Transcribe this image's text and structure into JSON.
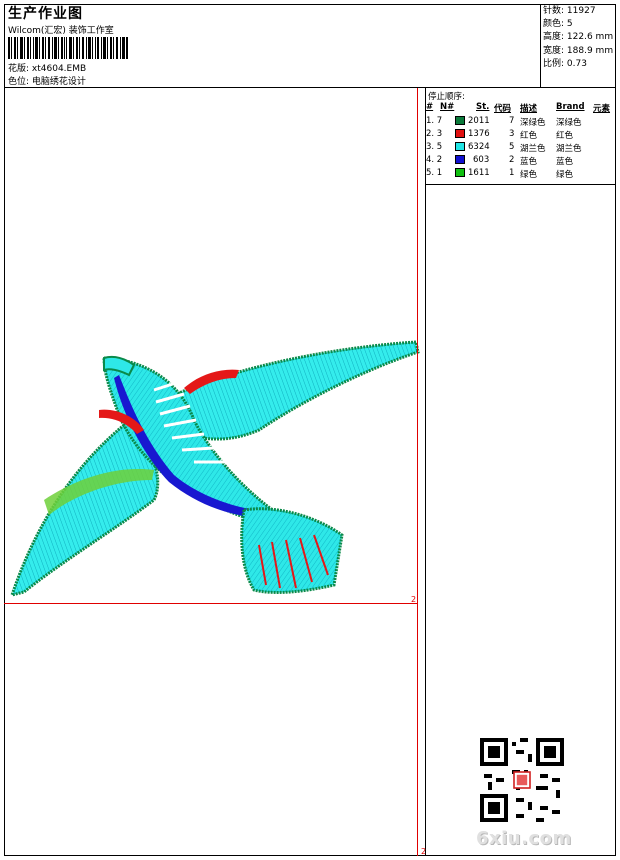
{
  "header": {
    "title": "生产作业图",
    "studio": "Wilcom(汇宏) 装饰工作室",
    "design_file_label": "花版:",
    "design_file": "xt4604.EMB",
    "color_position_label": "色位:",
    "color_position": "电脑绣花设计"
  },
  "stats": [
    {
      "label": "针数:",
      "value": "11927"
    },
    {
      "label": "颜色:",
      "value": "5"
    },
    {
      "label": "高度:",
      "value": "122.6 mm"
    },
    {
      "label": "宽度:",
      "value": "188.9 mm"
    },
    {
      "label": "比例:",
      "value": "0.73"
    }
  ],
  "sequence": {
    "title": "停止顺序:",
    "headers": {
      "hash": "#",
      "no": "N#",
      "st": "St.",
      "code": "代码",
      "desc": "描述",
      "brand": "Brand",
      "elem": "元素"
    },
    "rows": [
      {
        "hash": "1. 7",
        "color": "#0a7a3a",
        "st": "2011",
        "code": "7",
        "desc": "深绿色",
        "brand": "深绿色"
      },
      {
        "hash": "2. 3",
        "color": "#e01010",
        "st": "1376",
        "code": "3",
        "desc": "红色",
        "brand": "红色"
      },
      {
        "hash": "3. 5",
        "color": "#20e6e6",
        "st": "6324",
        "code": "5",
        "desc": "湖兰色",
        "brand": "湖兰色"
      },
      {
        "hash": "4. 2",
        "color": "#1010d0",
        "st": "603",
        "code": "2",
        "desc": "蓝色",
        "brand": "蓝色"
      },
      {
        "hash": "5. 1",
        "color": "#10c010",
        "st": "1611",
        "code": "1",
        "desc": "绿色",
        "brand": "绿色"
      }
    ]
  },
  "canvas": {
    "corner_right": "2",
    "corner_bottom": "2"
  },
  "watermark": {
    "site": "6xiu.com"
  }
}
